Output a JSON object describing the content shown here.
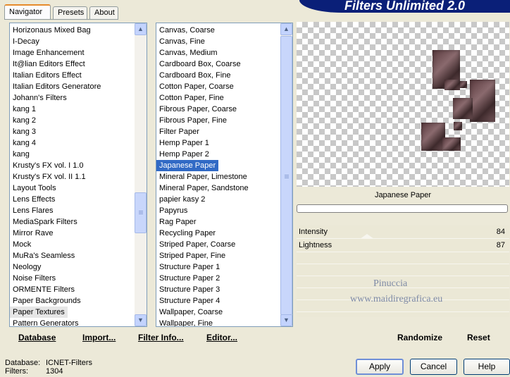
{
  "tabs": [
    "Navigator",
    "Presets",
    "About"
  ],
  "banner_title": "Filters Unlimited 2.0",
  "categories": {
    "items": [
      "Horizonaus Mixed Bag",
      "I-Decay",
      "Image Enhancement",
      "It@lian Editors Effect",
      "Italian Editors Effect",
      "Italian Editors Generatore",
      "Johann's Filters",
      "kang 1",
      "kang 2",
      "kang 3",
      "kang 4",
      "kang",
      "Krusty's FX vol. I 1.0",
      "Krusty's FX vol. II 1.1",
      "Layout Tools",
      "Lens Effects",
      "Lens Flares",
      "MediaSpark Filters",
      "Mirror Rave",
      "Mock",
      "MuRa's Seamless",
      "Neology",
      "Noise Filters",
      "ORMENTE Filters",
      "Paper Backgrounds",
      "Paper Textures",
      "Pattern Generators"
    ],
    "selected": "Paper Textures"
  },
  "filters": {
    "items": [
      "Canvas, Coarse",
      "Canvas, Fine",
      "Canvas, Medium",
      "Cardboard Box, Coarse",
      "Cardboard Box, Fine",
      "Cotton Paper, Coarse",
      "Cotton Paper, Fine",
      "Fibrous Paper, Coarse",
      "Fibrous Paper, Fine",
      "Filter Paper",
      "Hemp Paper 1",
      "Hemp Paper 2",
      "Japanese Paper",
      "Mineral Paper, Limestone",
      "Mineral Paper, Sandstone",
      "papier kasy 2",
      "Papyrus",
      "Rag Paper",
      "Recycling Paper",
      "Striped Paper, Coarse",
      "Striped Paper, Fine",
      "Structure Paper 1",
      "Structure Paper 2",
      "Structure Paper 3",
      "Structure Paper 4",
      "Wallpaper, Coarse",
      "Wallpaper, Fine"
    ],
    "selected": "Japanese Paper"
  },
  "preview": {
    "filter_name": "Japanese Paper",
    "progress": 0
  },
  "sliders": [
    {
      "label": "Intensity",
      "value": "84"
    },
    {
      "label": "Lightness",
      "value": "87"
    }
  ],
  "watermark": {
    "line1": "Pinuccia",
    "line2": "www.maidiregrafica.eu"
  },
  "toolbar": {
    "database": "Database",
    "import": "Import...",
    "filter_info": "Filter Info...",
    "editor": "Editor...",
    "randomize": "Randomize",
    "reset": "Reset"
  },
  "status": {
    "database_label": "Database:",
    "database_value": "ICNET-Filters",
    "filters_label": "Filters:",
    "filters_value": "1304"
  },
  "buttons": {
    "apply": "Apply",
    "cancel": "Cancel",
    "help": "Help"
  },
  "colors": {
    "banner": "#0a1f78",
    "selection": "#316ac5",
    "dialog_bg": "#ece9d8"
  }
}
